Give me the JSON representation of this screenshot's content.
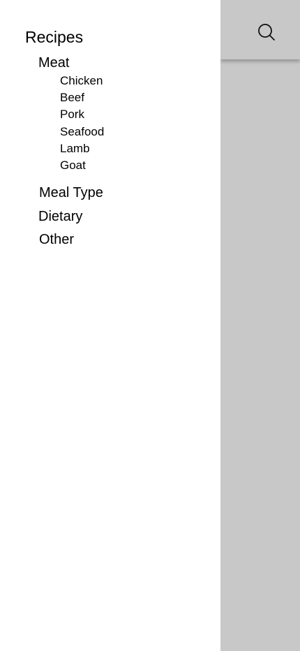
{
  "drawer": {
    "title": "Recipes",
    "sections": [
      {
        "label": "Meat",
        "items": [
          "Chicken",
          "Beef",
          "Pork",
          "Seafood",
          "Lamb",
          "Goat"
        ]
      },
      {
        "label": "Meal Type"
      },
      {
        "label": "Dietary"
      },
      {
        "label": "Other"
      }
    ]
  },
  "header": {
    "search_icon": "search-icon"
  },
  "colors": {
    "drawer_background": "#ffffff",
    "backdrop": "#c8c8c8",
    "text": "#000000"
  }
}
